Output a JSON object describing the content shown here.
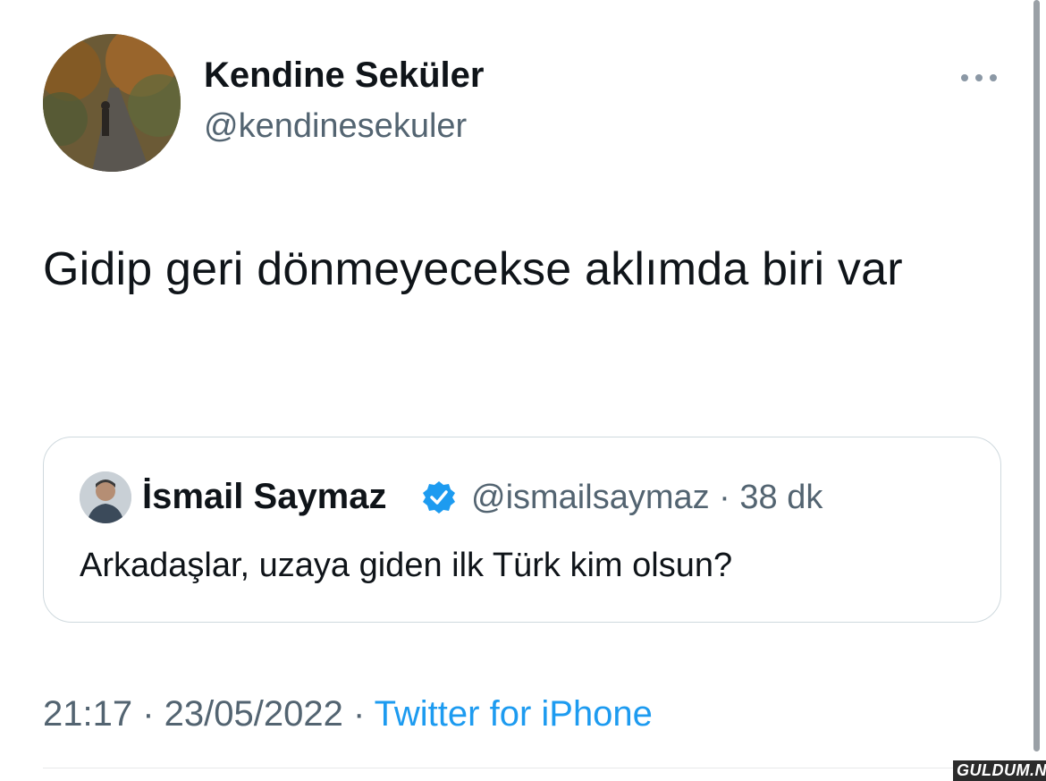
{
  "author": {
    "name": "Kendine Seküler",
    "handle": "@kendinesekuler"
  },
  "tweet": {
    "text": "Gidip geri dönmeyecekse aklımda biri var"
  },
  "quoted_tweet": {
    "name": "İsmail Saymaz",
    "handle_time": "@ismailsaymaz · 38 dk",
    "text": "Arkadaşlar, uzaya giden ilk Türk kim olsun?",
    "verified_color": "#1d9bf0"
  },
  "meta": {
    "time_date": "21:17 · 23/05/2022 · ",
    "source": "Twitter for iPhone"
  },
  "watermark": "GULDUM.NET",
  "icons": [
    "more-icon",
    "verified-badge-icon"
  ],
  "colors": {
    "accent": "#1d9bf0",
    "secondary_text": "#536471",
    "border": "#cfd9de"
  }
}
